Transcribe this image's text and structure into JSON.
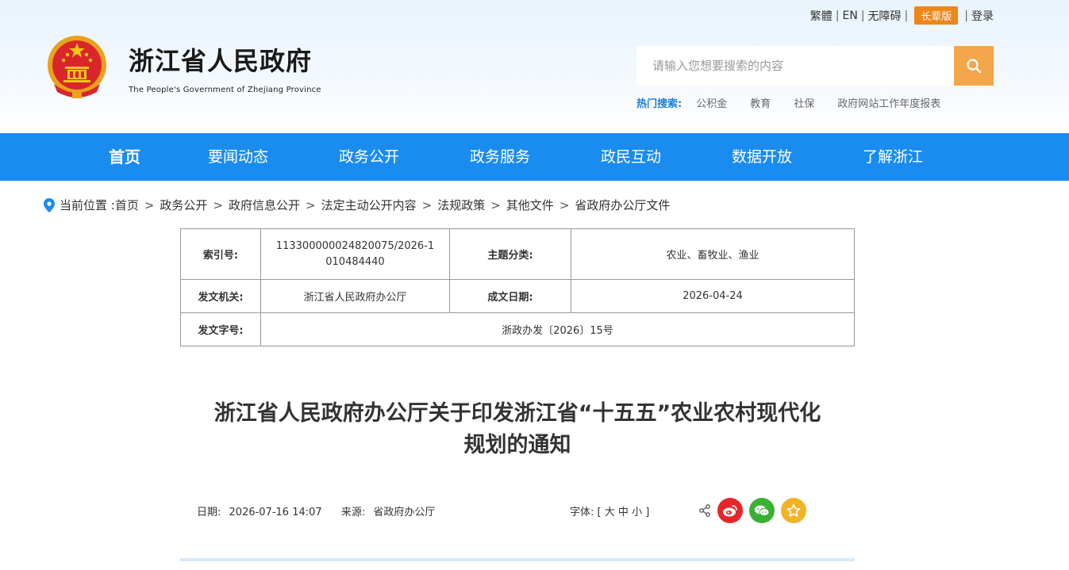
{
  "toplinks": {
    "traditional": "繁體",
    "english": "EN",
    "accessible": "无障碍",
    "elder": "长辈版",
    "login": "登录"
  },
  "site": {
    "title": "浙江省人民政府",
    "subtitle": "The People's Government of Zhejiang Province"
  },
  "search": {
    "placeholder": "请输入您想要搜索的内容"
  },
  "hot": {
    "label": "热门搜索:",
    "keywords": [
      "公积金",
      "教育",
      "社保",
      "政府网站工作年度报表"
    ]
  },
  "nav": [
    "首页",
    "要闻动态",
    "政务公开",
    "政务服务",
    "政民互动",
    "数据开放",
    "了解浙江"
  ],
  "breadcrumb": {
    "prefix": "当前位置 :",
    "items": [
      "首页",
      "政务公开",
      "政府信息公开",
      "法定主动公开内容",
      "法规政策",
      "其他文件",
      "省政府办公厅文件"
    ],
    "separator": ">"
  },
  "info": {
    "index_label": "索引号:",
    "index_value": "113300000024820075/2026-1010484440",
    "topic_label": "主题分类:",
    "topic_value": "农业、畜牧业、渔业",
    "issuer_label": "发文机关:",
    "issuer_value": "浙江省人民政府办公厅",
    "date_label": "成文日期:",
    "date_value": "2026-04-24",
    "docno_label": "发文字号:",
    "docno_value": "浙政办发〔2026〕15号"
  },
  "article": {
    "title_line1": "浙江省人民政府办公厅关于印发浙江省“十五五”农业农村现代化",
    "title_line2": "规划的通知",
    "date_label": "日期:",
    "date": "2026-07-16 14:07",
    "source_label": "来源:",
    "source": "省政府办公厅",
    "font_label": "字体:",
    "font_open": "[",
    "font_large": "大",
    "font_medium": "中",
    "font_small": "小",
    "font_close": "]"
  },
  "colors": {
    "nav_bg": "#1a8cf0",
    "search_btn": "#f4a64a",
    "elder_btn": "#f08519",
    "weibo": "#e6262c",
    "wechat": "#3cb035",
    "favorite": "#f0b429"
  }
}
